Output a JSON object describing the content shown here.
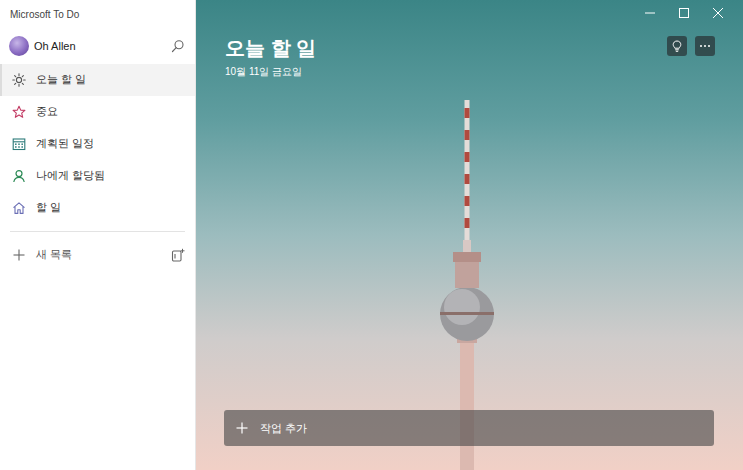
{
  "window": {
    "title": "Microsoft To Do"
  },
  "user": {
    "name": "Oh Allen"
  },
  "sidebar": {
    "items": [
      {
        "label": "오늘 할 일",
        "selected": true
      },
      {
        "label": "중요",
        "selected": false
      },
      {
        "label": "계획된 일정",
        "selected": false
      },
      {
        "label": "나에게 할당됨",
        "selected": false
      },
      {
        "label": "할 일",
        "selected": false
      }
    ]
  },
  "new_list": {
    "label": "새 목록"
  },
  "main": {
    "title": "오늘 할 일",
    "date": "10월 11일 금요일"
  },
  "add_task": {
    "label": "작업 추가"
  }
}
